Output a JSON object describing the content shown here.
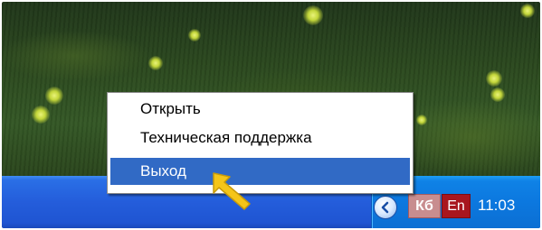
{
  "context_menu": {
    "items": [
      {
        "label": "Открыть",
        "selected": false
      },
      {
        "label": "Техническая поддержка",
        "selected": false
      },
      {
        "label": "Выход",
        "selected": true
      }
    ]
  },
  "tray": {
    "keyboard_badge": "Кб",
    "language_badge": "En",
    "clock": "11:03",
    "icons": [
      "show-hidden-icons-chevron-icon",
      "keyboard-layout-icon",
      "language-indicator-icon"
    ]
  },
  "cursor": {
    "icon": "yellow-arrow-pointer-icon",
    "color": "#f5c518"
  },
  "colors": {
    "selection": "#316ac5",
    "taskbar": "#245ddb",
    "tray": "#0c78df",
    "keyboard_badge": "#c88d8f",
    "language_badge": "#a8161e"
  }
}
